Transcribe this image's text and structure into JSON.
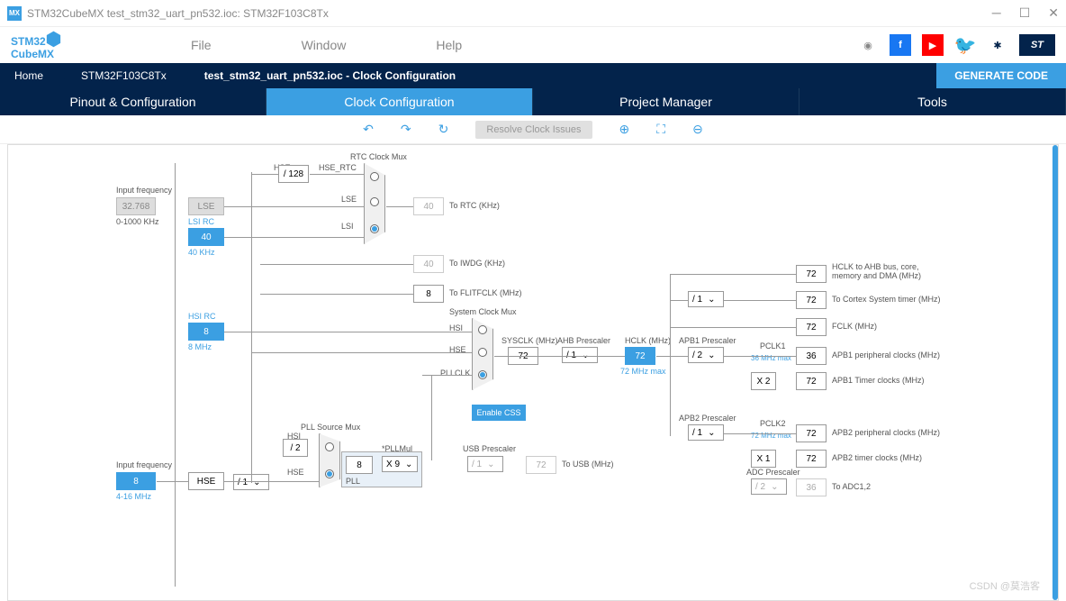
{
  "titlebar": {
    "icon_text": "MX",
    "text": "STM32CubeMX test_stm32_uart_pn532.ioc: STM32F103C8Tx"
  },
  "logo": {
    "line1": "STM32",
    "line2": "CubeMX"
  },
  "menu": {
    "file": "File",
    "window": "Window",
    "help": "Help"
  },
  "breadcrumb": {
    "home": "Home",
    "device": "STM32F103C8Tx",
    "file": "test_stm32_uart_pn532.ioc - Clock Configuration",
    "generate": "GENERATE CODE"
  },
  "tabs": {
    "pinout": "Pinout & Configuration",
    "clock": "Clock Configuration",
    "project": "Project Manager",
    "tools": "Tools"
  },
  "toolbar": {
    "resolve": "Resolve Clock Issues"
  },
  "clock": {
    "input_freq_label": "Input frequency",
    "lse_freq": "32.768",
    "lse_range": "0-1000 KHz",
    "lse": "LSE",
    "lsi_rc": "LSI RC",
    "lsi_val": "40",
    "lsi_unit": "40 KHz",
    "hsi_rc": "HSI RC",
    "hsi_val": "8",
    "hsi_unit": "8 MHz",
    "hse_freq": "8",
    "hse_range": "4-16 MHz",
    "hse": "HSE",
    "hse_div128": "/ 128",
    "hse_rtc": "HSE_RTC",
    "rtc_mux": "RTC Clock Mux",
    "lse_label": "LSE",
    "lsi_label": "LSI",
    "rtc_val": "40",
    "to_rtc": "To RTC (KHz)",
    "iwdg_val": "40",
    "to_iwdg": "To IWDG (KHz)",
    "flitf_val": "8",
    "to_flitf": "To FLITFCLK (MHz)",
    "hsi_div2": "/ 2",
    "hse_div1": "/ 1",
    "pll_source_mux": "PLL Source Mux",
    "hsi_label": "HSI",
    "hse_label": "HSE",
    "pll_val": "8",
    "pll_mul_label": "*PLLMul",
    "pll_mul": "X 9",
    "pll": "PLL",
    "sys_clock_mux": "System Clock Mux",
    "pllclk": "PLLCLK",
    "enable_css": "Enable CSS",
    "sysclk_label": "SYSCLK (MHz)",
    "sysclk_val": "72",
    "ahb_prescaler": "AHB Prescaler",
    "ahb_div": "/ 1",
    "hclk_label": "HCLK (MHz)",
    "hclk_val": "72",
    "hclk_max": "72 MHz max",
    "apb1_prescaler": "APB1 Prescaler",
    "apb1_div": "/ 2",
    "apb2_prescaler": "APB2 Prescaler",
    "apb2_div": "/ 1",
    "apb1_x2": "X 2",
    "apb2_x1": "X 1",
    "pclk1": "PCLK1",
    "pclk1_max": "36 MHz max",
    "pclk2": "PCLK2",
    "pclk2_max": "72 MHz max",
    "hclk_ahb": "72",
    "hclk_ahb_label": "HCLK to AHB bus, core, memory and DMA (MHz)",
    "cortex_div": "/ 1",
    "cortex_val": "72",
    "cortex_label": "To Cortex System timer (MHz)",
    "fclk_val": "72",
    "fclk_label": "FCLK (MHz)",
    "apb1_periph": "36",
    "apb1_periph_label": "APB1 peripheral clocks (MHz)",
    "apb1_timer": "72",
    "apb1_timer_label": "APB1 Timer clocks (MHz)",
    "apb2_periph": "72",
    "apb2_periph_label": "APB2 peripheral clocks (MHz)",
    "apb2_timer": "72",
    "apb2_timer_label": "APB2 timer clocks (MHz)",
    "adc_prescaler": "ADC Prescaler",
    "adc_div": "/ 2",
    "adc_val": "36",
    "adc_label": "To ADC1,2",
    "usb_prescaler": "USB Prescaler",
    "usb_div": "/ 1",
    "usb_val": "72",
    "usb_label": "To USB (MHz)"
  },
  "watermark": "CSDN @莫浩客"
}
